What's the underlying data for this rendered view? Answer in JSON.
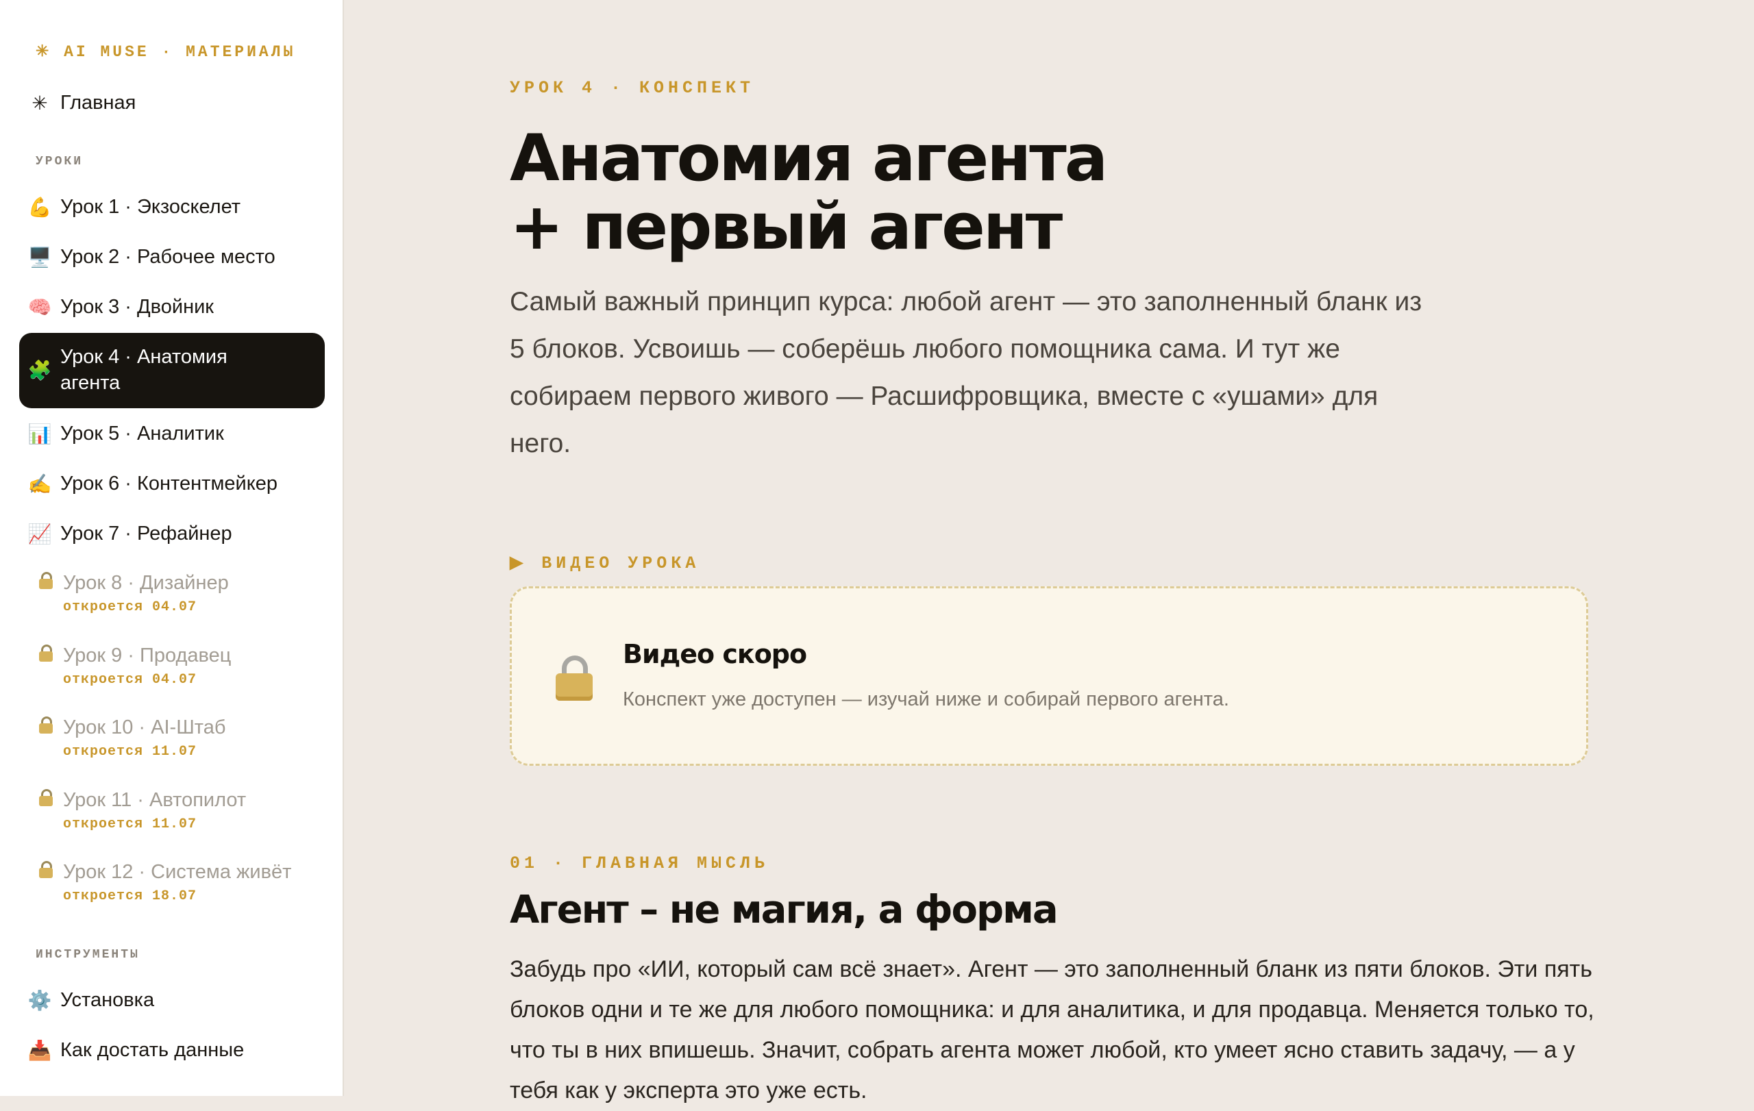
{
  "sidebar": {
    "brand": "✳ AI MUSE · МАТЕРИАЛЫ",
    "home": {
      "icon": "✳",
      "label": "Главная"
    },
    "lessons_label": "УРОКИ",
    "lessons": [
      {
        "icon": "💪",
        "label": "Урок 1 · Экзоскелет"
      },
      {
        "icon": "🖥️",
        "label": "Урок 2 · Рабочее место"
      },
      {
        "icon": "🧠",
        "label": "Урок 3 · Двойник"
      },
      {
        "icon": "🧩",
        "label": "Урок 4 · Анатомия агента",
        "active": true
      },
      {
        "icon": "📊",
        "label": "Урок 5 · Аналитик"
      },
      {
        "icon": "✍️",
        "label": "Урок 6 · Контентмейкер"
      },
      {
        "icon": "📈",
        "label": "Урок 7 · Рефайнер"
      }
    ],
    "locked_lessons": [
      {
        "icon": "lock-icon",
        "label": "Урок 8 · Дизайнер",
        "opens": "откроется 04.07"
      },
      {
        "icon": "lock-icon",
        "label": "Урок 9 · Продавец",
        "opens": "откроется 04.07"
      },
      {
        "icon": "lock-icon",
        "label": "Урок 10 · AI-Штаб",
        "opens": "откроется 11.07"
      },
      {
        "icon": "lock-icon",
        "label": "Урок 11 · Автопилот",
        "opens": "откроется 11.07"
      },
      {
        "icon": "lock-icon",
        "label": "Урок 12 · Система живёт",
        "opens": "откроется 18.07"
      }
    ],
    "tools_label": "ИНСТРУМЕНТЫ",
    "tools": [
      {
        "icon": "⚙️",
        "label": "Установка"
      },
      {
        "icon": "📥",
        "label": "Как достать данные"
      }
    ]
  },
  "main": {
    "kicker": "УРОК 4 · КОНСПЕКТ",
    "title_line1": "Анатомия агента",
    "title_line2": "+ первый агент",
    "lead": "Самый важный принцип курса: любой агент — это заполненный бланк из 5 блоков. Усвоишь — соберёшь любого помощника сама. И тут же собираем первого живого — Расшифровщика, вместе с «ушами» для него.",
    "video_section_label": "▶ ВИДЕО УРОКА",
    "video_card": {
      "title": "Видео скоро",
      "subtitle": "Конспект уже доступен — изучай ниже и собирай первого агента."
    },
    "section1_kicker": "01 · ГЛАВНАЯ МЫСЛЬ",
    "section1_title": "Агент – не магия, а форма",
    "section1_body": "Забудь про «ИИ, который сам всё знает». Агент — это заполненный бланк из пяти блоков. Эти пять блоков одни и те же для любого помощника: и для аналитика, и для продавца. Меняется только то, что ты в них впишешь. Значит, собрать агента может любой, кто умеет ясно ставить задачу, — а у тебя как у эксперта это уже есть."
  },
  "colors": {
    "accent": "#c8962a",
    "page_bg": "#efe9e3",
    "sidebar_bg": "#ffffff",
    "active_bg": "#17140f",
    "video_card_bg": "#fbf6ea"
  }
}
